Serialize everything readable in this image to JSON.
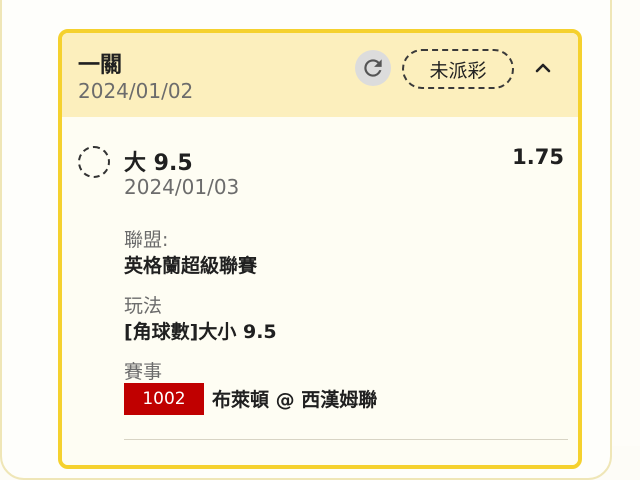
{
  "bet": {
    "type": "一關",
    "date": "2024/01/02",
    "status": "未派彩",
    "icons": {
      "refresh": "refresh-icon",
      "collapse": "chevron-up-icon",
      "select": "select-circle-icon"
    }
  },
  "selection": {
    "name": "大 9.5",
    "odds": "1.75",
    "date": "2024/01/03"
  },
  "league": {
    "label": "聯盟:",
    "value": "英格蘭超級聯賽"
  },
  "play": {
    "label": "玩法",
    "value": "[角球數]大小 9.5"
  },
  "match": {
    "label": "賽事",
    "number": "1002",
    "teams": "布萊頓 @ 西漢姆聯"
  },
  "colors": {
    "accent": "#f5d12e",
    "header_bg": "#fcefbd",
    "match_badge": "#c00000"
  }
}
